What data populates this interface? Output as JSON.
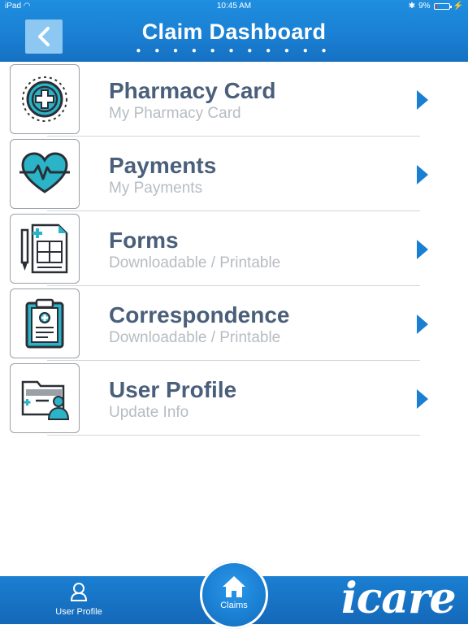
{
  "status_bar": {
    "device": "iPad",
    "time": "10:45 AM",
    "battery": "9%"
  },
  "header": {
    "title": "Claim Dashboard",
    "page_dots": "● ● ● ● ● ● ● ● ● ● ●"
  },
  "rows": [
    {
      "label": "Pharmacy Card",
      "sub": "My Pharmacy Card",
      "icon": "medical-cross-icon"
    },
    {
      "label": "Payments",
      "sub": "My Payments",
      "icon": "heartbeat-icon"
    },
    {
      "label": "Forms",
      "sub": "Downloadable / Printable",
      "icon": "forms-icon"
    },
    {
      "label": "Correspondence",
      "sub": "Downloadable / Printable",
      "icon": "clipboard-icon"
    },
    {
      "label": "User Profile",
      "sub": "Update Info",
      "icon": "profile-folder-icon"
    }
  ],
  "tabbar": {
    "profile_label": "User Profile",
    "claims_label": "Claims",
    "brand": "icare"
  },
  "colors": {
    "primary": "#1a7fd2",
    "accent": "#2bb3c8",
    "label": "#4a5f7a",
    "sublabel": "#b7bcc2"
  }
}
